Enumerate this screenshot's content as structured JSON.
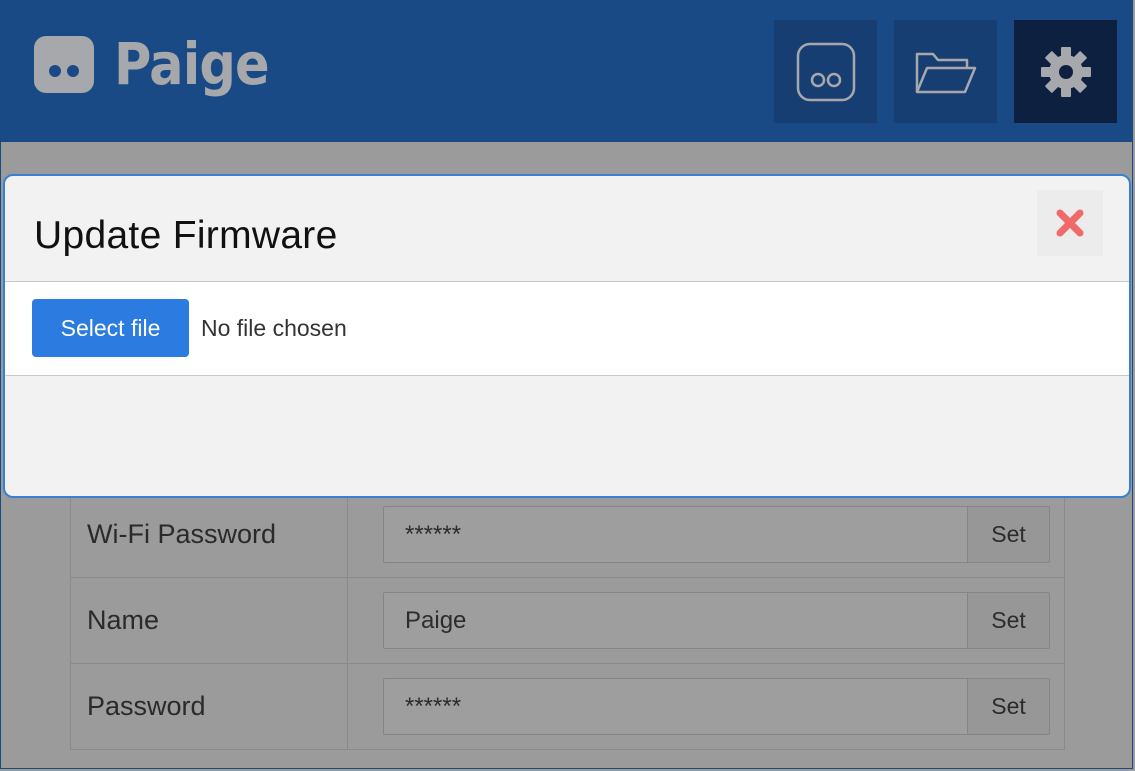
{
  "app": {
    "title": "Paige",
    "accent": "#1a4a85"
  },
  "header": {
    "buttons": [
      {
        "icon": "paige-face-icon",
        "label": "Paige"
      },
      {
        "icon": "folder-icon",
        "label": "Files"
      },
      {
        "icon": "gear-icon",
        "label": "Settings",
        "active": true
      }
    ]
  },
  "settings": {
    "rows": [
      {
        "label": "Wi-Fi Password",
        "value": "******",
        "button": "Set"
      },
      {
        "label": "Name",
        "value": "Paige",
        "button": "Set"
      },
      {
        "label": "Password",
        "value": "******",
        "button": "Set"
      }
    ]
  },
  "modal": {
    "title": "Update Firmware",
    "close_icon": "close-icon",
    "select_file_label": "Select file",
    "file_status": "No file chosen",
    "close_color": "#f06a6a",
    "primary_color": "#2b7be0"
  }
}
